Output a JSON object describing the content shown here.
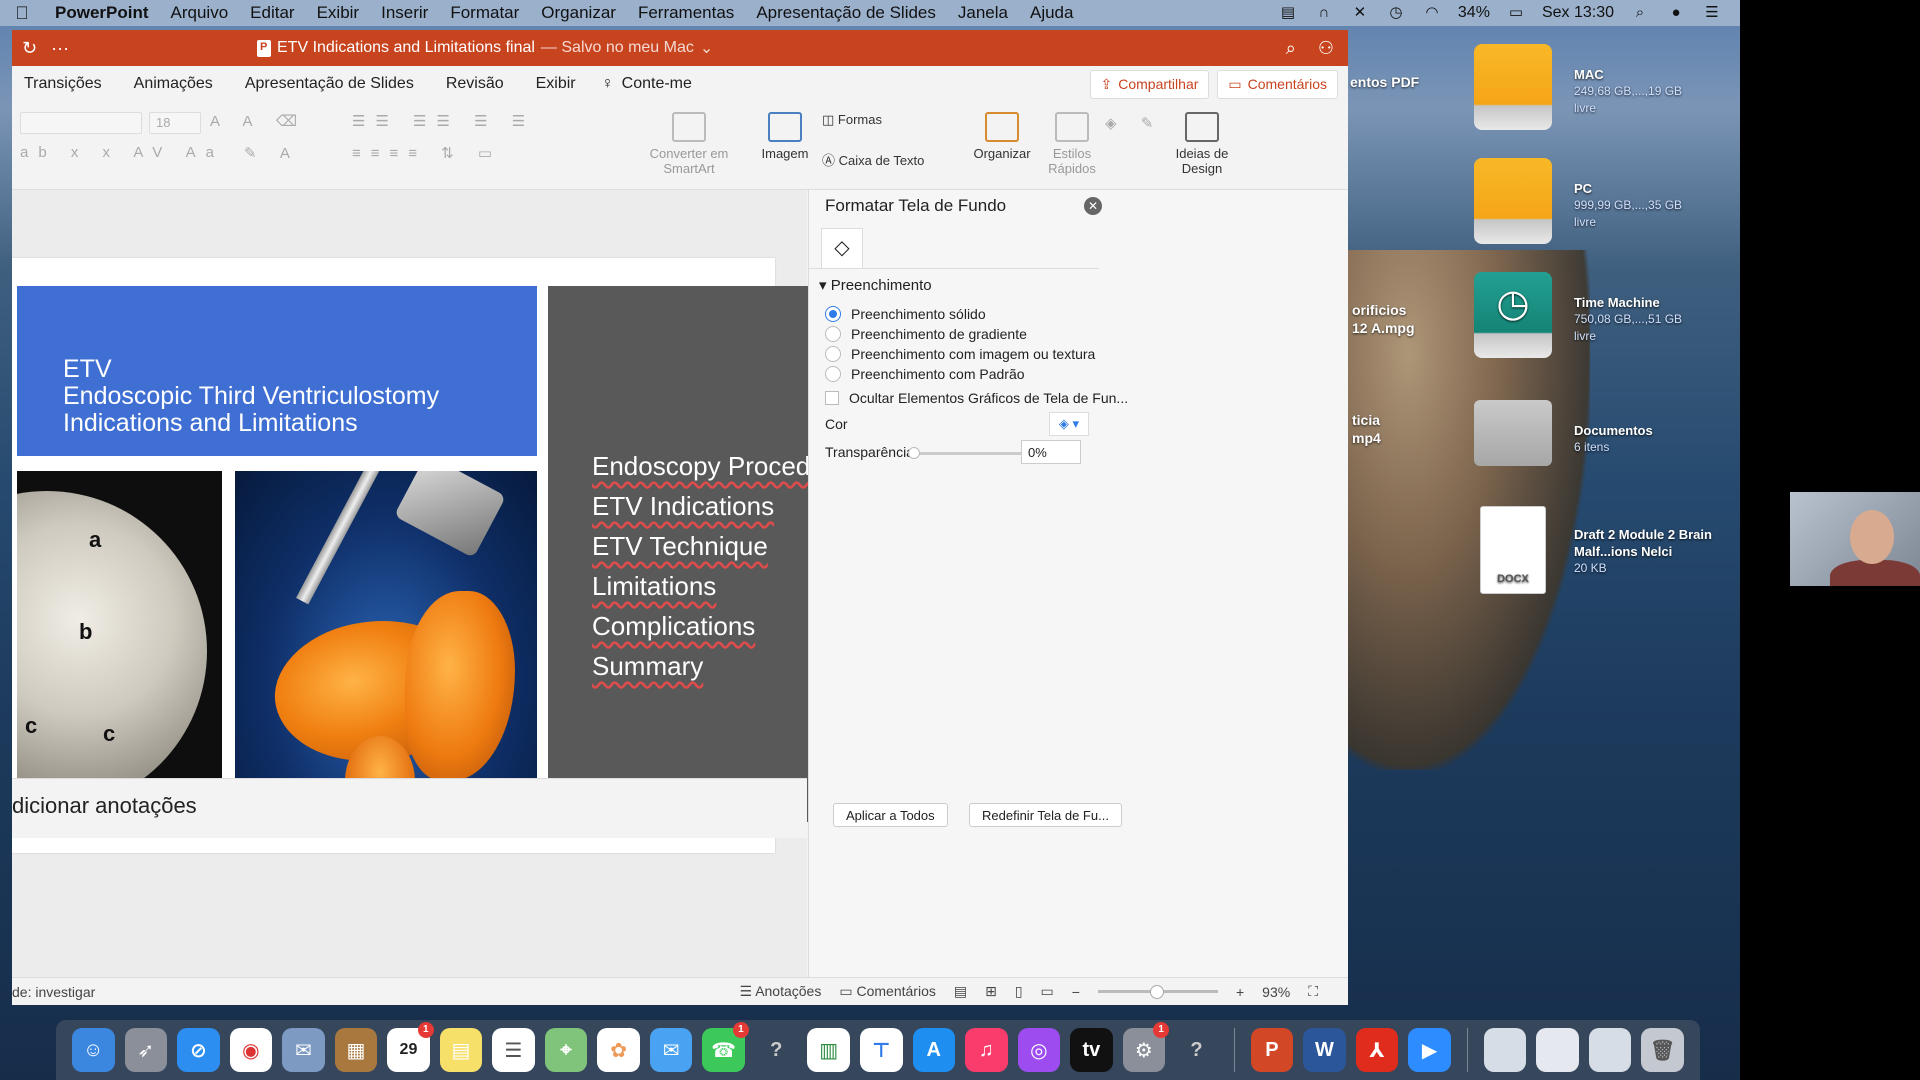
{
  "menubar": {
    "app": "PowerPoint",
    "items": [
      "Arquivo",
      "Editar",
      "Exibir",
      "Inserir",
      "Formatar",
      "Organizar",
      "Ferramentas",
      "Apresentação de Slides",
      "Janela",
      "Ajuda"
    ],
    "battery": "34%",
    "clock": "Sex 13:30"
  },
  "window": {
    "title": "ETV Indications and Limitations final",
    "saved_status": "— Salvo no meu Mac",
    "tabs": [
      "Transições",
      "Animações",
      "Apresentação de Slides",
      "Revisão",
      "Exibir"
    ],
    "tell_me": "Conte-me",
    "share_label": "Compartilhar",
    "comments_label": "Comentários"
  },
  "ribbon": {
    "font_size": "18",
    "convert_smartart": "Converter em SmartArt",
    "image_label": "Imagem",
    "shapes_label": "Formas",
    "textbox_label": "Caixa de Texto",
    "arrange_label": "Organizar",
    "quick_styles_label": "Estilos Rápidos",
    "design_ideas_label": "Ideias de Design"
  },
  "slide": {
    "banner_lines": [
      "ETV",
      "Endoscopic Third Ventriculostomy",
      "Indications and Limitations"
    ],
    "topics": [
      "Endoscopy Procedures",
      "ETV Indications",
      "ETV Technique",
      "Limitations",
      "Complications",
      "Summary"
    ],
    "photo_labels": [
      "a",
      "b",
      "c",
      "c"
    ]
  },
  "notes": {
    "placeholder": "dicionar anotações"
  },
  "format_pane": {
    "title": "Formatar Tela de Fundo",
    "section": "Preenchimento",
    "options": [
      "Preenchimento sólido",
      "Preenchimento de gradiente",
      "Preenchimento com imagem ou textura",
      "Preenchimento com Padrão"
    ],
    "selected_option_index": 0,
    "hide_graphics": "Ocultar Elementos Gráficos de Tela de Fun...",
    "color_label": "Cor",
    "transparency_label": "Transparência",
    "transparency_value": "0%",
    "apply_all": "Aplicar a Todos",
    "reset": "Redefinir Tela de Fu..."
  },
  "statusbar": {
    "left": "de: investigar",
    "notes": "Anotações",
    "comments": "Comentários",
    "zoom": "93%"
  },
  "desktop": {
    "left_labels": [
      "entos PDF",
      "orificios",
      "12 A.mpg",
      "ticia",
      "mp4"
    ],
    "icons": [
      {
        "name": "MAC",
        "sub": "249,68 GB,...,19 GB livre"
      },
      {
        "name": "PC",
        "sub": "999,99 GB,...,35 GB livre"
      },
      {
        "name": "Time Machine",
        "sub": "750,08 GB,...,51 GB livre"
      },
      {
        "name": "Documentos",
        "sub": "6 itens"
      },
      {
        "name": "Draft 2 Module 2 Brain Malf...ions Nelci",
        "sub": "20 KB",
        "ext": "DOCX"
      }
    ]
  },
  "dock": {
    "calendar_day": "29"
  },
  "colors": {
    "title_bar": "#c8441f",
    "banner": "#3f6fd2",
    "dark_panel": "#595959",
    "accent": "#2f7be8"
  }
}
